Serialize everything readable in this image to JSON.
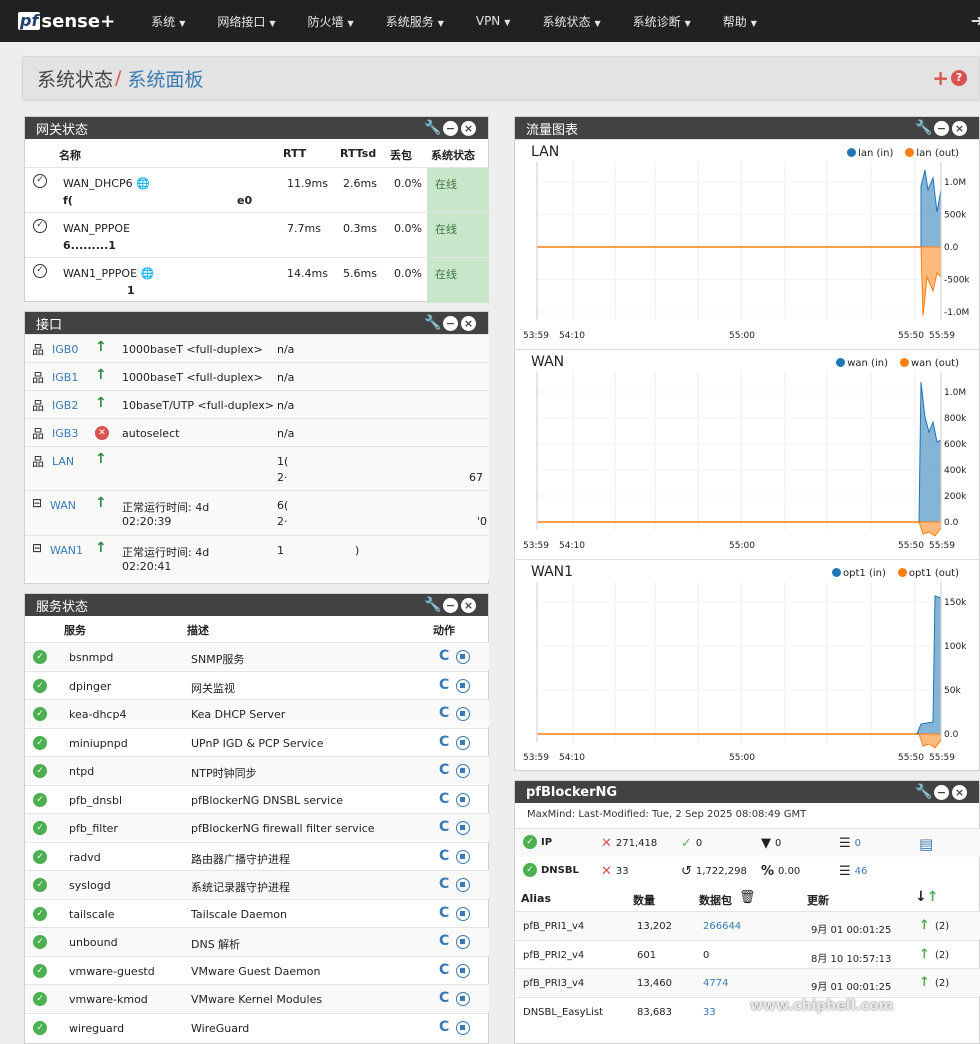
{
  "nav": {
    "logo_pf": "pf",
    "logo_sense": "sense+",
    "items": [
      "系统",
      "网络接口",
      "防火墙",
      "系统服务",
      "VPN",
      "系统状态",
      "系统诊断",
      "帮助"
    ]
  },
  "breadcrumb": {
    "parent": "系统状态",
    "sep": "/",
    "current": "系统面板"
  },
  "gateways": {
    "title": "网关状态",
    "headers": [
      "名称",
      "RTT",
      "RTTsd",
      "丢包",
      "系统状态"
    ],
    "rows": [
      {
        "name": "WAN_DHCP6",
        "addr_a": "f(",
        "addr_b": "e0",
        "rtt": "11.9ms",
        "rttsd": "2.6ms",
        "loss": "0.0%",
        "status": "在线"
      },
      {
        "name": "WAN_PPPOE",
        "addr_a": "6.........1",
        "addr_b": "",
        "rtt": "7.7ms",
        "rttsd": "0.3ms",
        "loss": "0.0%",
        "status": "在线"
      },
      {
        "name": "WAN1_PPPOE",
        "addr_a": "",
        "addr_b": "1",
        "rtt": "14.4ms",
        "rttsd": "5.6ms",
        "loss": "0.0%",
        "status": "在线"
      }
    ]
  },
  "interfaces": {
    "title": "接口",
    "rows": [
      {
        "name": "IGB0",
        "media": "1000baseT <full-duplex>",
        "ip": "n/a",
        "ip2": ""
      },
      {
        "name": "IGB1",
        "media": "1000baseT <full-duplex>",
        "ip": "n/a",
        "ip2": ""
      },
      {
        "name": "IGB2",
        "media": "10baseT/UTP <full-duplex>",
        "ip": "n/a",
        "ip2": ""
      },
      {
        "name": "IGB3",
        "media": "autoselect",
        "ip": "n/a",
        "ip2": ""
      },
      {
        "name": "LAN",
        "media": "",
        "ip": "1(",
        "ip2": "2·",
        "ip_tail": "67"
      },
      {
        "name": "WAN",
        "media": "正常运行时间:  4d",
        "media2": "02:20:39",
        "ip": "6(",
        "ip2": "2·",
        "ip_tail": "'0"
      },
      {
        "name": "WAN1",
        "media": "正常运行时间:  4d",
        "media2": "02:20:41",
        "ip": "1",
        "ip2": "",
        "ip_tail": ")"
      }
    ]
  },
  "services": {
    "title": "服务状态",
    "headers": [
      "服务",
      "描述",
      "动作"
    ],
    "rows": [
      {
        "name": "bsnmpd",
        "desc": "SNMP服务"
      },
      {
        "name": "dpinger",
        "desc": "网关监视"
      },
      {
        "name": "kea-dhcp4",
        "desc": "Kea DHCP Server"
      },
      {
        "name": "miniupnpd",
        "desc": "UPnP IGD & PCP Service"
      },
      {
        "name": "ntpd",
        "desc": "NTP时钟同步"
      },
      {
        "name": "pfb_dnsbl",
        "desc": "pfBlockerNG DNSBL service"
      },
      {
        "name": "pfb_filter",
        "desc": "pfBlockerNG firewall filter service"
      },
      {
        "name": "radvd",
        "desc": "路由器广播守护进程"
      },
      {
        "name": "syslogd",
        "desc": "系统记录器守护进程"
      },
      {
        "name": "tailscale",
        "desc": "Tailscale Daemon"
      },
      {
        "name": "unbound",
        "desc": "DNS 解析"
      },
      {
        "name": "vmware-guestd",
        "desc": "VMware Guest Daemon"
      },
      {
        "name": "vmware-kmod",
        "desc": "VMware Kernel Modules"
      },
      {
        "name": "wireguard",
        "desc": "WireGuard"
      }
    ]
  },
  "traffic": {
    "title": "流量图表",
    "colors": {
      "in": "#1f77b4",
      "out": "#ff7f0e"
    },
    "graphs": [
      {
        "title": "LAN",
        "legend_in": "lan (in)",
        "legend_out": "lan (out)",
        "yticks": [
          "1.0M",
          "500k",
          "0.0",
          "-500k",
          "-1.0M"
        ],
        "xticks": [
          "53:59",
          "54:10",
          "55:00",
          "55:50",
          "55:59"
        ]
      },
      {
        "title": "WAN",
        "legend_in": "wan (in)",
        "legend_out": "wan (out)",
        "yticks": [
          "1.0M",
          "800k",
          "600k",
          "400k",
          "200k",
          "0.0"
        ],
        "xticks": [
          "53:59",
          "54:10",
          "55:00",
          "55:50",
          "55:59"
        ]
      },
      {
        "title": "WAN1",
        "legend_in": "opt1 (in)",
        "legend_out": "opt1 (out)",
        "yticks": [
          "150k",
          "100k",
          "50k",
          "0.0"
        ],
        "xticks": [
          "53:59",
          "54:10",
          "55:00",
          "55:50",
          "55:59"
        ]
      }
    ]
  },
  "pfblocker": {
    "title": "pfBlockerNG",
    "subtitle": "MaxMind: Last-Modified: Tue, 2 Sep 2025 08:08:49 GMT",
    "ip": {
      "label": "IP",
      "blocked": "271,418",
      "ok": "0",
      "filter": "0",
      "list": "0"
    },
    "dnsbl": {
      "label": "DNSBL",
      "blocked": "33",
      "history": "1,722,298",
      "pct": "0.00",
      "list": "46"
    },
    "headers": [
      "Alias",
      "数量",
      "数据包",
      "更新"
    ],
    "rows": [
      {
        "alias": "pfB_PRI1_v4",
        "count": "13,202",
        "packets": "266644",
        "updated": "9月 01 00:01:25",
        "extra": "(2)"
      },
      {
        "alias": "pfB_PRI2_v4",
        "count": "601",
        "packets": "0",
        "updated": "8月 10 10:57:13",
        "extra": "(2)"
      },
      {
        "alias": "pfB_PRI3_v4",
        "count": "13,460",
        "packets": "4774",
        "updated": "9月 01 00:01:25",
        "extra": "(2)"
      },
      {
        "alias": "DNSBL_EasyList",
        "count": "83,683",
        "packets": "33",
        "updated": "",
        "extra": ""
      }
    ]
  },
  "watermark": "www.chiphell.com"
}
